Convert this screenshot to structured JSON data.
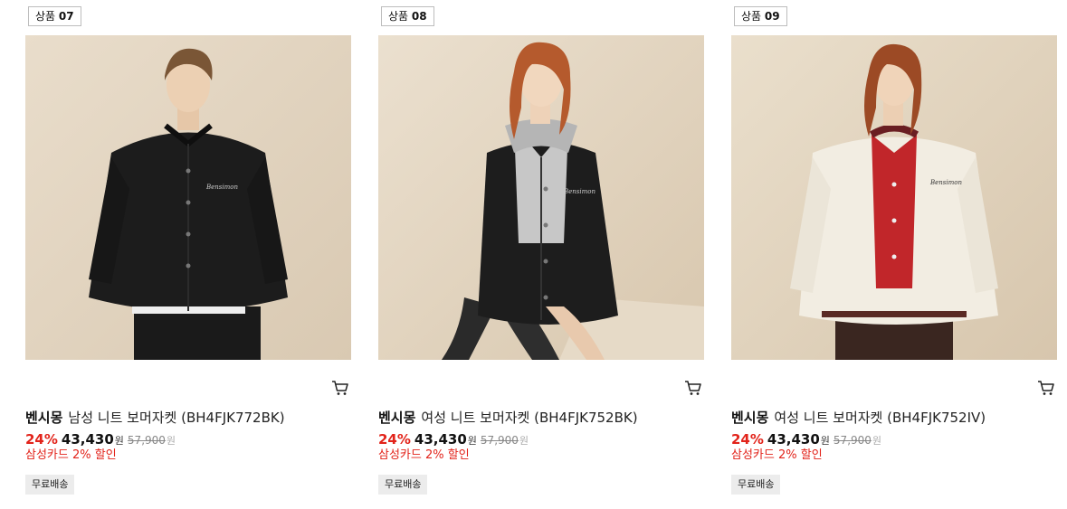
{
  "products": [
    {
      "tag_prefix": "상품",
      "tag_num": "07",
      "image_alt": "male model wearing black knit bomber jacket",
      "brand": "벤시몽",
      "name": "남성 니트 보머자켓 (BH4FJK772BK)",
      "discount_rate": "24%",
      "sale_price": "43,430",
      "sale_unit": "원",
      "original_price": "57,900",
      "original_unit": "원",
      "card_discount": "삼성카드 2% 할인",
      "badge": "무료배송",
      "cart_icon": "cart-icon"
    },
    {
      "tag_prefix": "상품",
      "tag_num": "08",
      "image_alt": "female model wearing black knit bomber jacket over grey hoodie",
      "brand": "벤시몽",
      "name": "여성 니트 보머자켓 (BH4FJK752BK)",
      "discount_rate": "24%",
      "sale_price": "43,430",
      "sale_unit": "원",
      "original_price": "57,900",
      "original_unit": "원",
      "card_discount": "삼성카드 2% 할인",
      "badge": "무료배송",
      "cart_icon": "cart-icon"
    },
    {
      "tag_prefix": "상품",
      "tag_num": "09",
      "image_alt": "female model wearing ivory knit bomber jacket over red cardigan",
      "brand": "벤시몽",
      "name": "여성 니트 보머자켓 (BH4FJK752IV)",
      "discount_rate": "24%",
      "sale_price": "43,430",
      "sale_unit": "원",
      "original_price": "57,900",
      "original_unit": "원",
      "card_discount": "삼성카드 2% 할인",
      "badge": "무료배송",
      "cart_icon": "cart-icon"
    }
  ],
  "colors": {
    "accent_red": "#e2231a",
    "photo_bg": "#e4d8c6",
    "badge_bg": "#ececec"
  }
}
